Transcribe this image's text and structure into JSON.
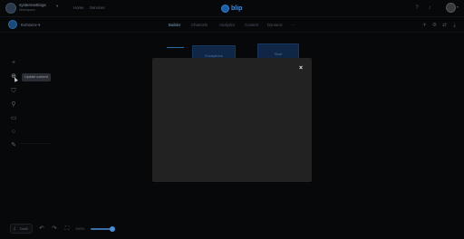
{
  "workspace": {
    "name": "systemsettings",
    "subtitle": "Workspace",
    "caret": "▾"
  },
  "topnav": {
    "links": [
      "Home",
      "Services"
    ],
    "brand": "blip",
    "icons": [
      "help-icon",
      "notifications-icon",
      "settings-icon"
    ]
  },
  "user": {
    "caret": "▾"
  },
  "bot": {
    "name": "BotName ▾"
  },
  "tabs": [
    {
      "label": "Builder",
      "active": true
    },
    {
      "label": "Channels",
      "active": false
    },
    {
      "label": "Analytics",
      "active": false
    },
    {
      "label": "Content",
      "active": false
    },
    {
      "label": "Dynamic",
      "active": false
    },
    {
      "label": "···",
      "active": false
    }
  ],
  "subbar_icons": [
    "publish-icon",
    "settings-icon",
    "share-icon",
    "download-icon"
  ],
  "toolbar": {
    "items": [
      {
        "name": "add-icon",
        "glyph": "+"
      },
      {
        "name": "add-content-icon",
        "glyph": "⊕"
      },
      {
        "name": "bookmark-icon",
        "glyph": "⛉"
      },
      {
        "name": "search-content-icon",
        "glyph": "⚲"
      },
      {
        "name": "folder-icon",
        "glyph": "▭"
      },
      {
        "name": "zoom-search-icon",
        "glyph": "○"
      },
      {
        "name": "brush-icon",
        "glyph": "✎"
      }
    ],
    "tooltip": "Update content"
  },
  "canvas": {
    "nodes": [
      {
        "label": "Exceptions"
      },
      {
        "label": "Start"
      }
    ]
  },
  "modal": {
    "close_glyph": "×"
  },
  "bottom": {
    "share_label": "Draft",
    "share_glyph": "⤓",
    "undo_glyph": "↶",
    "redo_glyph": "↷",
    "fullscreen_glyph": "⛶",
    "zoom_label": "100%",
    "zoom_level": 0.9
  },
  "colors": {
    "background": "#07080a",
    "modal": "#222222",
    "accent": "#4d8fd6",
    "node": "#0f2646"
  }
}
